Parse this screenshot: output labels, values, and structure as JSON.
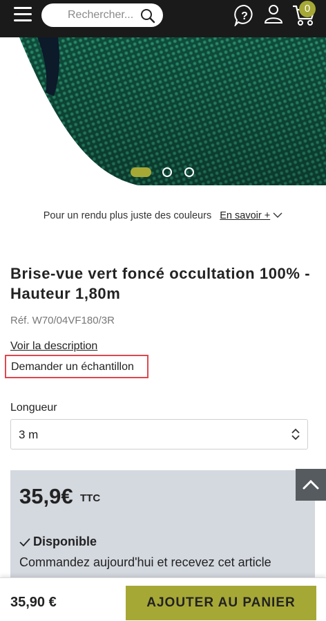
{
  "header": {
    "search_placeholder": "Rechercher...",
    "cart_count": "0",
    "icons": [
      "menu-icon",
      "search-icon",
      "help-icon",
      "user-icon",
      "cart-icon"
    ]
  },
  "gallery": {
    "slide_count": 3,
    "active_slide": 1
  },
  "colors_note": {
    "text": "Pour un rendu plus juste des couleurs",
    "link": "En savoir +"
  },
  "product": {
    "title": "Brise-vue vert foncé occultation 100% - Hauteur 1,80m",
    "ref": "Réf. W70/04VF180/3R",
    "description_link": "Voir la description",
    "sample_link": "Demander un échantillon"
  },
  "length": {
    "label": "Longueur",
    "selected": "3 m"
  },
  "price_box": {
    "price": "35,9€",
    "tax_label": "TTC",
    "availability": "Disponible",
    "order_text": "Commandez aujourd'hui et recevez cet article"
  },
  "bottom_bar": {
    "price": "35,90 €",
    "add_to_cart": "AJOUTER AU PANIER"
  },
  "colors": {
    "accent": "#a6a836",
    "header_bg": "#1a1a1a",
    "price_box_bg": "#d4d8df",
    "highlight": "#e0464d"
  }
}
